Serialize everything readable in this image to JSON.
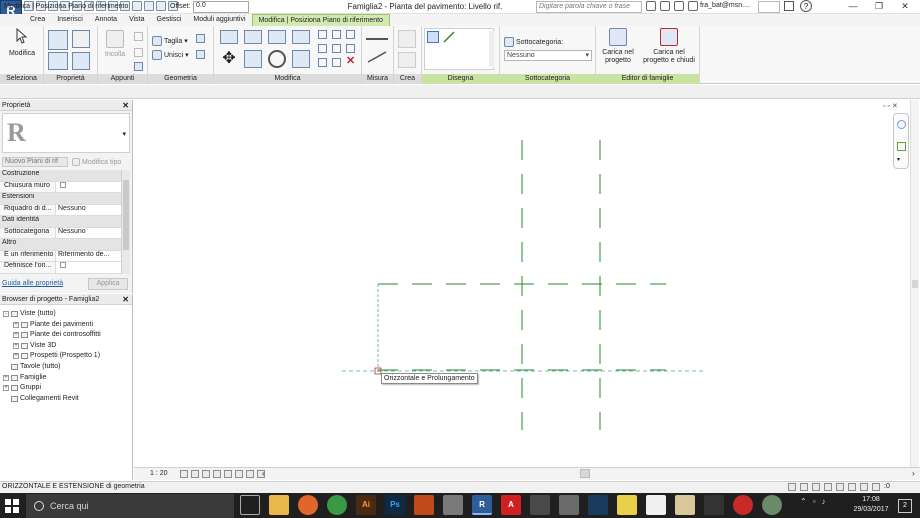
{
  "window": {
    "title": "Famiglia2 - Pianta del pavimento: Livello rif.",
    "search_placeholder": "Digitare parola chiave o frase",
    "user": "fra_bat@msn....",
    "app_button": "R",
    "help": "?"
  },
  "ribbon_tabs": [
    {
      "label": "Crea"
    },
    {
      "label": "Inserisci"
    },
    {
      "label": "Annota"
    },
    {
      "label": "Vista"
    },
    {
      "label": "Gestisci"
    },
    {
      "label": "Moduli aggiuntivi"
    },
    {
      "label": "Modifica | Posiziona Piano di riferimento",
      "active": true
    }
  ],
  "ribbon": {
    "modifica": "Modifica",
    "seleziona": "Seleziona",
    "proprieta": "Proprietà",
    "incolla": "Incolla",
    "appunti": "Appunti",
    "taglia": "Taglia",
    "unisci": "Unisci",
    "geometria": "Geometria",
    "modifica_panel": "Modifica",
    "misura": "Misura",
    "crea": "Crea",
    "disegna": "Disegna",
    "sottocategoria_label": "Sottocategoria:",
    "sottocategoria_value": "Nessuno",
    "sottocategoria_panel": "Sottocategoria",
    "carica_progetto": "Carica nel progetto",
    "carica_chiudi": "Carica nel progetto e chiudi",
    "editor_famiglie": "Editor di famiglie"
  },
  "options_bar": {
    "title": "Modifica | Posiziona Piano di riferimento",
    "offset_label": "Offset:",
    "offset_value": "0.0"
  },
  "properties": {
    "header": "Proprietà",
    "type_selector": "Nuovo Piani di rif",
    "edit_type": "Modifica tipo",
    "rows": [
      {
        "cat": "Costruzione"
      },
      {
        "k": "Chiusura muro",
        "v": "",
        "checkbox": true
      },
      {
        "cat": "Estensioni"
      },
      {
        "k": "Riquadro di d...",
        "v": "Nessuno"
      },
      {
        "cat": "Dati identità"
      },
      {
        "k": "Sottocategoria",
        "v": "Nessuno"
      },
      {
        "cat": "Altro"
      },
      {
        "k": "È un riferimento",
        "v": "Riferimento de..."
      },
      {
        "k": "Definisce l'ori...",
        "v": "",
        "checkbox": true
      }
    ],
    "help_link": "Guida alle proprietà",
    "apply": "Applica"
  },
  "browser": {
    "header": "Browser di progetto - Famiglia2",
    "items": [
      {
        "label": "Viste (tutto)",
        "level": 0,
        "exp": "-"
      },
      {
        "label": "Piante dei pavimenti",
        "level": 1,
        "exp": "+"
      },
      {
        "label": "Piante dei controsoffitti",
        "level": 1,
        "exp": "+"
      },
      {
        "label": "Viste 3D",
        "level": 1,
        "exp": "+"
      },
      {
        "label": "Prospetti (Prospetto 1)",
        "level": 1,
        "exp": "+"
      },
      {
        "label": "Tavole (tutto)",
        "level": 0,
        "exp": ""
      },
      {
        "label": "Famiglie",
        "level": 0,
        "exp": "+"
      },
      {
        "label": "Gruppi",
        "level": 0,
        "exp": "+"
      },
      {
        "label": "Collegamenti Revit",
        "level": 0,
        "exp": ""
      }
    ]
  },
  "canvas": {
    "tooltip": "Orizzontale e Prolungamento",
    "scale": "1 : 20"
  },
  "status": {
    "text": "ORIZZONTALE E ESTENSIONE di geometria",
    "filter_count": ":0"
  },
  "taskbar": {
    "search": "Cerca qui",
    "time": "17:08",
    "date": "29/03/2017",
    "notif": "2"
  },
  "colors": {
    "accent": "#c9e3a3",
    "ref_plane": "#2a8a2a",
    "sketch": "#4aa6a6",
    "taskbar": "#1f1f1f"
  }
}
